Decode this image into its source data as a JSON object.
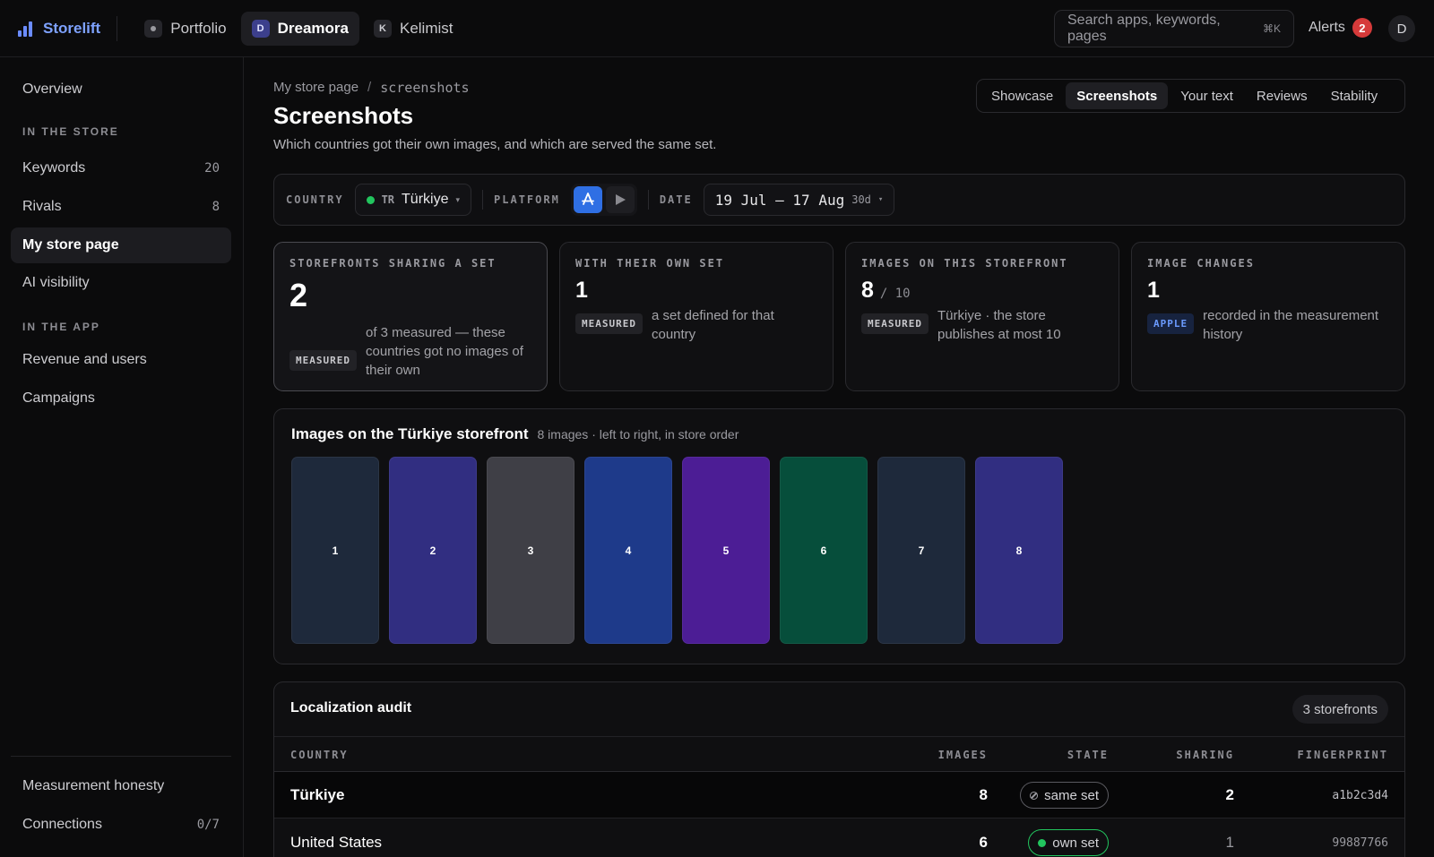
{
  "brand": {
    "name": "Storelift"
  },
  "app_tabs": [
    {
      "badge": "",
      "label": "Portfolio",
      "active": false
    },
    {
      "badge": "D",
      "label": "Dreamora",
      "active": true
    },
    {
      "badge": "K",
      "label": "Kelimist",
      "active": false
    }
  ],
  "search": {
    "placeholder": "Search apps, keywords, pages",
    "shortcut": "⌘K"
  },
  "alerts": {
    "label": "Alerts",
    "count": "2"
  },
  "user": {
    "initial": "D"
  },
  "sidebar": {
    "overview": "Overview",
    "section_store": "IN THE STORE",
    "keywords": {
      "label": "Keywords",
      "count": "20"
    },
    "rivals": {
      "label": "Rivals",
      "count": "8"
    },
    "store_page": "My store page",
    "ai_visibility": "AI visibility",
    "section_app": "IN THE APP",
    "revenue": "Revenue and users",
    "campaigns": "Campaigns",
    "honesty": "Measurement honesty",
    "connections": {
      "label": "Connections",
      "count": "0/7"
    }
  },
  "breadcrumb": {
    "parent": "My store page",
    "sep": "/",
    "current": "screenshots"
  },
  "page": {
    "title": "Screenshots",
    "subtitle": "Which countries got their own images, and which are served the same set."
  },
  "segments": [
    "Showcase",
    "Screenshots",
    "Your text",
    "Reviews",
    "Stability"
  ],
  "active_segment": "Screenshots",
  "filters": {
    "country_label": "COUNTRY",
    "country_code": "TR",
    "country_name": "Türkiye",
    "platform_label": "PLATFORM",
    "date_label": "DATE",
    "date_range": "19 Jul – 17 Aug",
    "date_span": "30d"
  },
  "cards": [
    {
      "label": "STOREFRONTS SHARING A SET",
      "value": "2",
      "of": "",
      "tag": "MEASURED",
      "note": "of 3 measured — these countries got no images of their own"
    },
    {
      "label": "WITH THEIR OWN SET",
      "value": "1",
      "of": "",
      "tag": "MEASURED",
      "note": "a set defined for that country"
    },
    {
      "label": "IMAGES ON THIS STOREFRONT",
      "value": "8",
      "of": "/ 10",
      "tag": "MEASURED",
      "note": "Türkiye · the store publishes at most 10"
    },
    {
      "label": "IMAGE CHANGES",
      "value": "1",
      "of": "",
      "tag": "APPLE",
      "note": "recorded in the measurement history"
    }
  ],
  "images_panel": {
    "title": "Images on the Türkiye storefront",
    "subtitle": "8 images · left to right, in store order",
    "shots": [
      {
        "n": "1",
        "color": "#1e293b"
      },
      {
        "n": "2",
        "color": "#312e81"
      },
      {
        "n": "3",
        "color": "#3f3f46"
      },
      {
        "n": "4",
        "color": "#1e3a8a"
      },
      {
        "n": "5",
        "color": "#4c1d95"
      },
      {
        "n": "6",
        "color": "#064e3b"
      },
      {
        "n": "7",
        "color": "#1e293b"
      },
      {
        "n": "8",
        "color": "#312e81"
      }
    ]
  },
  "audit": {
    "title": "Localization audit",
    "pill": "3 storefronts",
    "columns": {
      "country": "COUNTRY",
      "images": "IMAGES",
      "state": "STATE",
      "sharing": "SHARING",
      "fingerprint": "FINGERPRINT"
    },
    "rows": [
      {
        "country": "Türkiye",
        "images": "8",
        "state": "same set",
        "sharing": "2",
        "fingerprint": "a1b2c3d4"
      },
      {
        "country": "United States",
        "images": "6",
        "state": "own set",
        "sharing": "1",
        "fingerprint": "99887766"
      }
    ]
  },
  "colors": {
    "accent": "#7ea2ff",
    "green": "#22c55e",
    "alert": "#d63a3a",
    "apple_blue": "#2f6fe4"
  }
}
